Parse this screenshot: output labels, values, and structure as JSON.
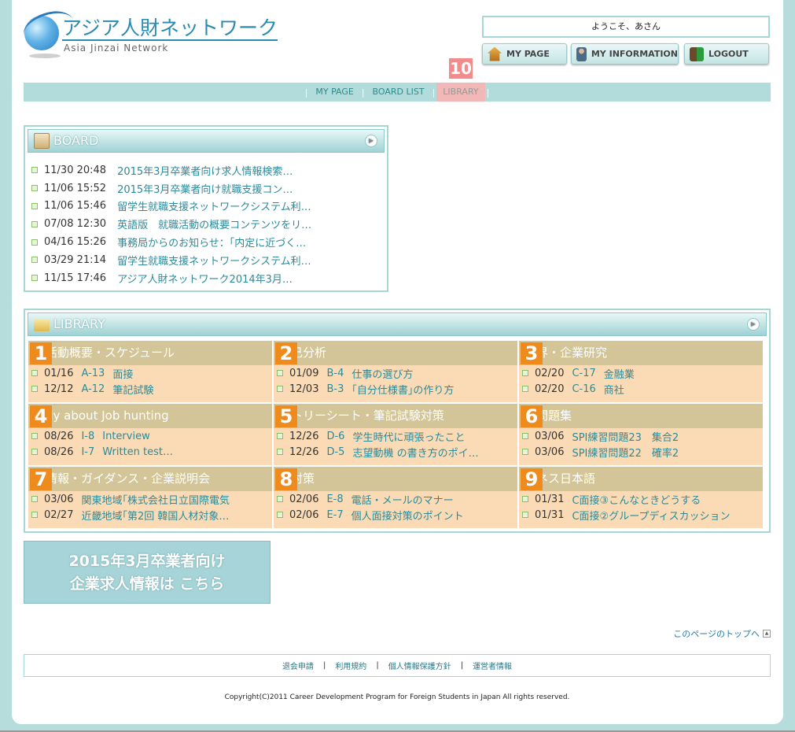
{
  "header": {
    "logo_jp": "アジア人財ネットワーク",
    "logo_en": "Asia Jinzai Network",
    "welcome": "ようこそ、あさん",
    "buttons": {
      "mypage": "MY PAGE",
      "myinfo": "MY INFORMATION",
      "logout": "LOGOUT"
    },
    "badge": "10"
  },
  "nav": {
    "items": [
      "MY PAGE",
      "BOARD LIST",
      "LIBRARY"
    ]
  },
  "board": {
    "title": "BOARD",
    "items": [
      {
        "date": "11/30 20:48",
        "title": "2015年3月卒業者向け求人情報検索…"
      },
      {
        "date": "11/06 15:52",
        "title": "2015年3月卒業者向け就職支援コン…"
      },
      {
        "date": "11/06 15:46",
        "title": "留学生就職支援ネットワークシステム利…"
      },
      {
        "date": "07/08 12:30",
        "title": "英語版　就職活動の概要コンテンツをリ…"
      },
      {
        "date": "04/16 15:26",
        "title": "事務局からのお知らせ：｢内定に近づく…"
      },
      {
        "date": "03/29 21:14",
        "title": "留学生就職支援ネットワークシステム利…"
      },
      {
        "date": "11/15 17:46",
        "title": "アジア人財ネットワーク2014年3月…"
      }
    ]
  },
  "library": {
    "title": "LIBRARY",
    "cells": [
      {
        "num": "1",
        "head": "活動概要・スケジュール",
        "rows": [
          {
            "date": "01/16",
            "code": "A-13",
            "title": "面接"
          },
          {
            "date": "12/12",
            "code": "A-12",
            "title": "筆記試験"
          }
        ]
      },
      {
        "num": "2",
        "head": "己分析",
        "rows": [
          {
            "date": "01/09",
            "code": "B-4",
            "title": "仕事の選び方"
          },
          {
            "date": "12/03",
            "code": "B-3",
            "title": "｢自分仕様書｣の作り方"
          }
        ]
      },
      {
        "num": "3",
        "head": "界・企業研究",
        "rows": [
          {
            "date": "02/20",
            "code": "C-17",
            "title": "金融業"
          },
          {
            "date": "02/20",
            "code": "C-16",
            "title": "商社"
          }
        ]
      },
      {
        "num": "4",
        "head": "dy about Job hunting",
        "rows": [
          {
            "date": "08/26",
            "code": "I-8",
            "title": "Interview"
          },
          {
            "date": "08/26",
            "code": "I-7",
            "title": "Written test…"
          }
        ]
      },
      {
        "num": "5",
        "head": "トリーシート・筆記試験対策",
        "rows": [
          {
            "date": "12/26",
            "code": "D-6",
            "title": "学生時代に頑張ったこと"
          },
          {
            "date": "12/26",
            "code": "D-5",
            "title": "志望動機 の書き方のポイ…"
          }
        ]
      },
      {
        "num": "6",
        "head": "問題集",
        "rows": [
          {
            "date": "03/06",
            "code": "",
            "title": "SPI練習問題23　集合2"
          },
          {
            "date": "03/06",
            "code": "",
            "title": "SPI練習問題22　確率2"
          }
        ]
      },
      {
        "num": "7",
        "head": "情報・ガイダンス・企業説明会",
        "rows": [
          {
            "date": "03/06",
            "code": "",
            "title": "関東地域｢株式会社日立国際電気"
          },
          {
            "date": "02/27",
            "code": "",
            "title": "近畿地域｢第2回 韓国人材対象…"
          }
        ]
      },
      {
        "num": "8",
        "head": "対策",
        "rows": [
          {
            "date": "02/06",
            "code": "E-8",
            "title": "電話・メールのマナー"
          },
          {
            "date": "02/06",
            "code": "E-7",
            "title": "個人面接対策のポイント"
          }
        ]
      },
      {
        "num": "9",
        "head": "ネス日本語",
        "rows": [
          {
            "date": "01/31",
            "code": "",
            "title": "C面接③こんなときどうする"
          },
          {
            "date": "01/31",
            "code": "",
            "title": "C面接②グループディスカッション"
          }
        ]
      }
    ]
  },
  "banner": {
    "line1": "2015年3月卒業者向け",
    "line2": "企業求人情報は こちら"
  },
  "to_top": "このページのトップへ",
  "footer": {
    "links": [
      "退会申請",
      "利用規約",
      "個人情報保護方針",
      "運営者情報"
    ],
    "copyright": "Copyright(C)2011 Career Development Program for Foreign Students in Japan All rights reserved."
  }
}
